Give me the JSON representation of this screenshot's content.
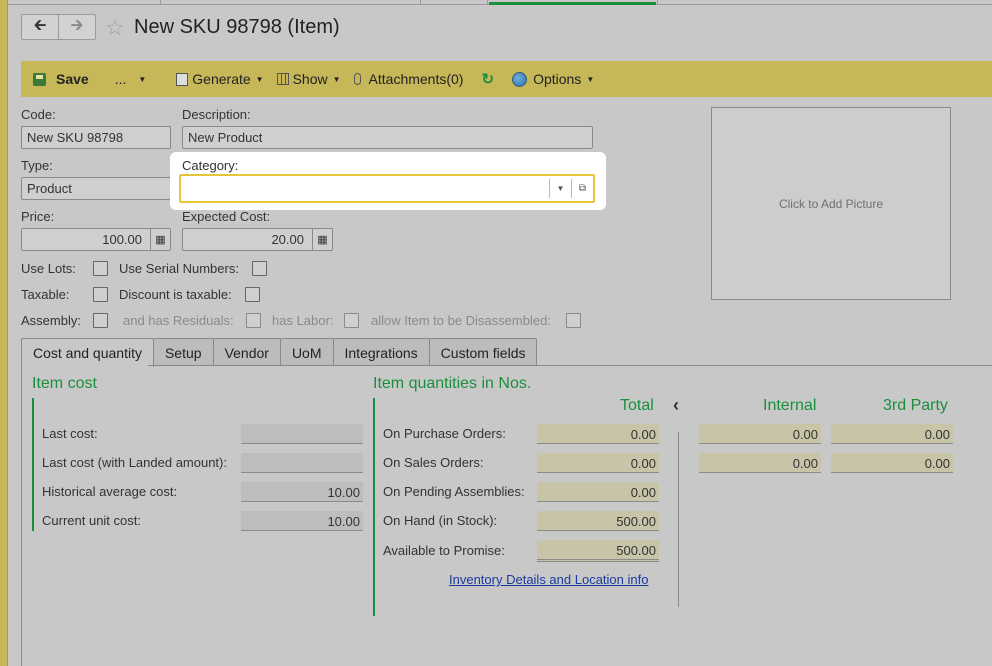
{
  "header": {
    "title": "New SKU 98798 (Item)"
  },
  "toolbar": {
    "save": "Save",
    "more": "...",
    "generate": "Generate",
    "show": "Show",
    "attachments": "Attachments(0)",
    "options": "Options"
  },
  "form": {
    "code_label": "Code:",
    "code_value": "New SKU 98798",
    "description_label": "Description:",
    "description_value": "New Product",
    "type_label": "Type:",
    "type_value": "Product",
    "category_label": "Category:",
    "category_value": "",
    "price_label": "Price:",
    "price_value": "100.00",
    "expected_cost_label": "Expected Cost:",
    "expected_cost_value": "20.00",
    "picture_text": "Click to Add Picture",
    "use_lots": "Use Lots:",
    "use_serial": "Use Serial Numbers:",
    "taxable": "Taxable:",
    "discount_taxable": "Discount is taxable:",
    "assembly": "Assembly:",
    "has_residuals": "and has Residuals:",
    "has_labor": "has Labor:",
    "allow_disassembled": "allow Item to be Disassembled:"
  },
  "tabs": [
    "Cost and quantity",
    "Setup",
    "Vendor",
    "UoM",
    "Integrations",
    "Custom fields"
  ],
  "item_cost": {
    "title": "Item cost",
    "rows": [
      {
        "label": "Last cost:",
        "value": ""
      },
      {
        "label": "Last cost (with Landed amount):",
        "value": ""
      },
      {
        "label": "Historical average cost:",
        "value": "10.00"
      },
      {
        "label": "Current unit cost:",
        "value": "10.00"
      }
    ]
  },
  "item_qty": {
    "title": "Item quantities in Nos.",
    "col_total": "Total",
    "col_internal": "Internal",
    "col_third": "3rd Party",
    "rows": [
      {
        "label": "On Purchase Orders:",
        "total": "0.00",
        "internal": "0.00",
        "third": "0.00"
      },
      {
        "label": "On Sales Orders:",
        "total": "0.00",
        "internal": "0.00",
        "third": "0.00"
      },
      {
        "label": "On Pending Assemblies:",
        "total": "0.00"
      },
      {
        "label": "On Hand (in Stock):",
        "total": "500.00"
      },
      {
        "label": "Available to Promise:",
        "total": "500.00"
      }
    ],
    "link": "Inventory Details and Location info"
  }
}
